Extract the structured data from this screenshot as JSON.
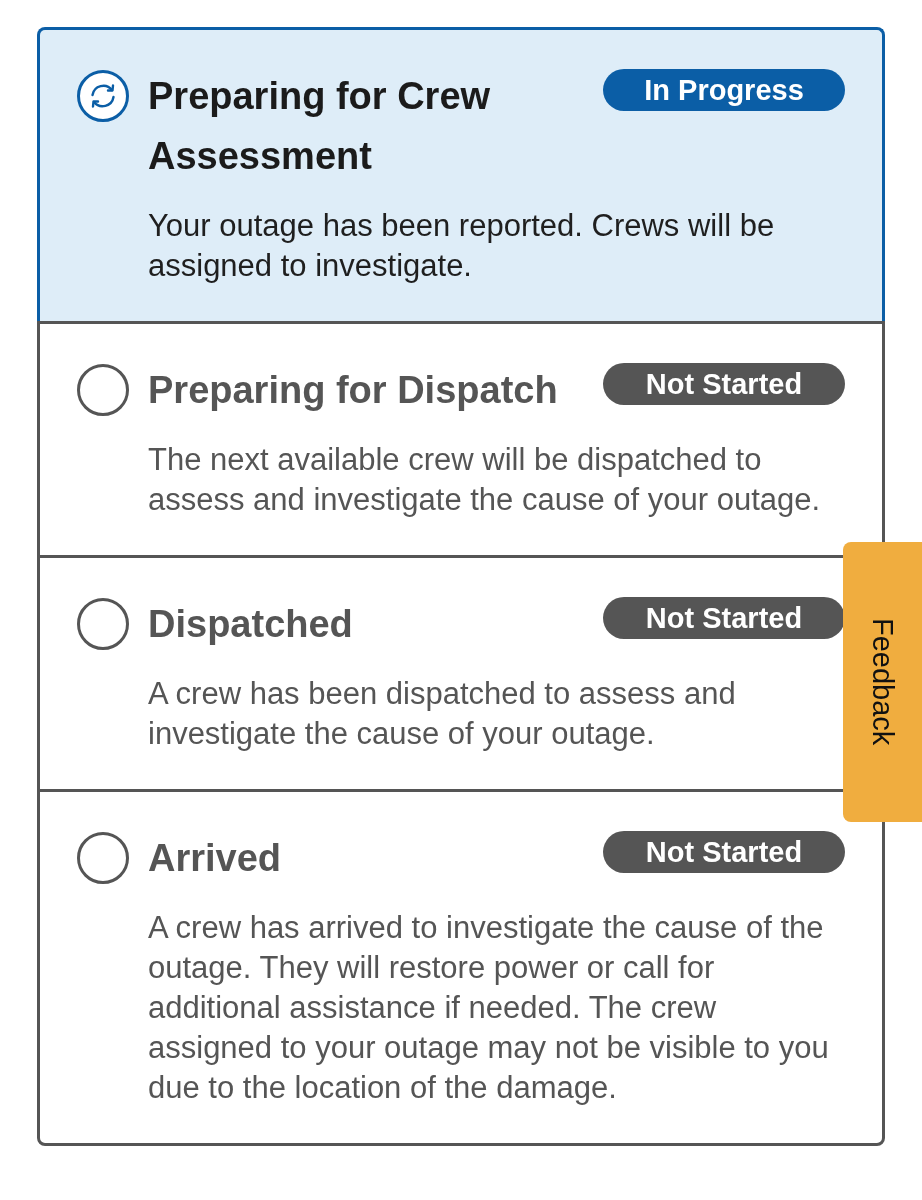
{
  "steps": [
    {
      "kind": "in-progress",
      "title": "Preparing for Crew Assessment",
      "status": "In Progress",
      "description": "Your outage has been reported. Crews will be assigned to investigate."
    },
    {
      "kind": "not-started",
      "title": "Preparing for Dispatch",
      "status": "Not Started",
      "description": "The next available crew will be dispatched to assess and investigate the cause of your outage."
    },
    {
      "kind": "not-started",
      "title": "Dispatched",
      "status": "Not Started",
      "description": "A crew has been dispatched to assess and investigate the cause of your outage."
    },
    {
      "kind": "not-started",
      "title": "Arrived",
      "status": "Not Started",
      "description": "A crew has arrived to investigate the cause of the outage. They will restore power or call for additional assistance if needed. The crew assigned to your outage may not be visible to you due to the location of the damage."
    }
  ],
  "feedback_tab": {
    "label": "Feedback"
  }
}
